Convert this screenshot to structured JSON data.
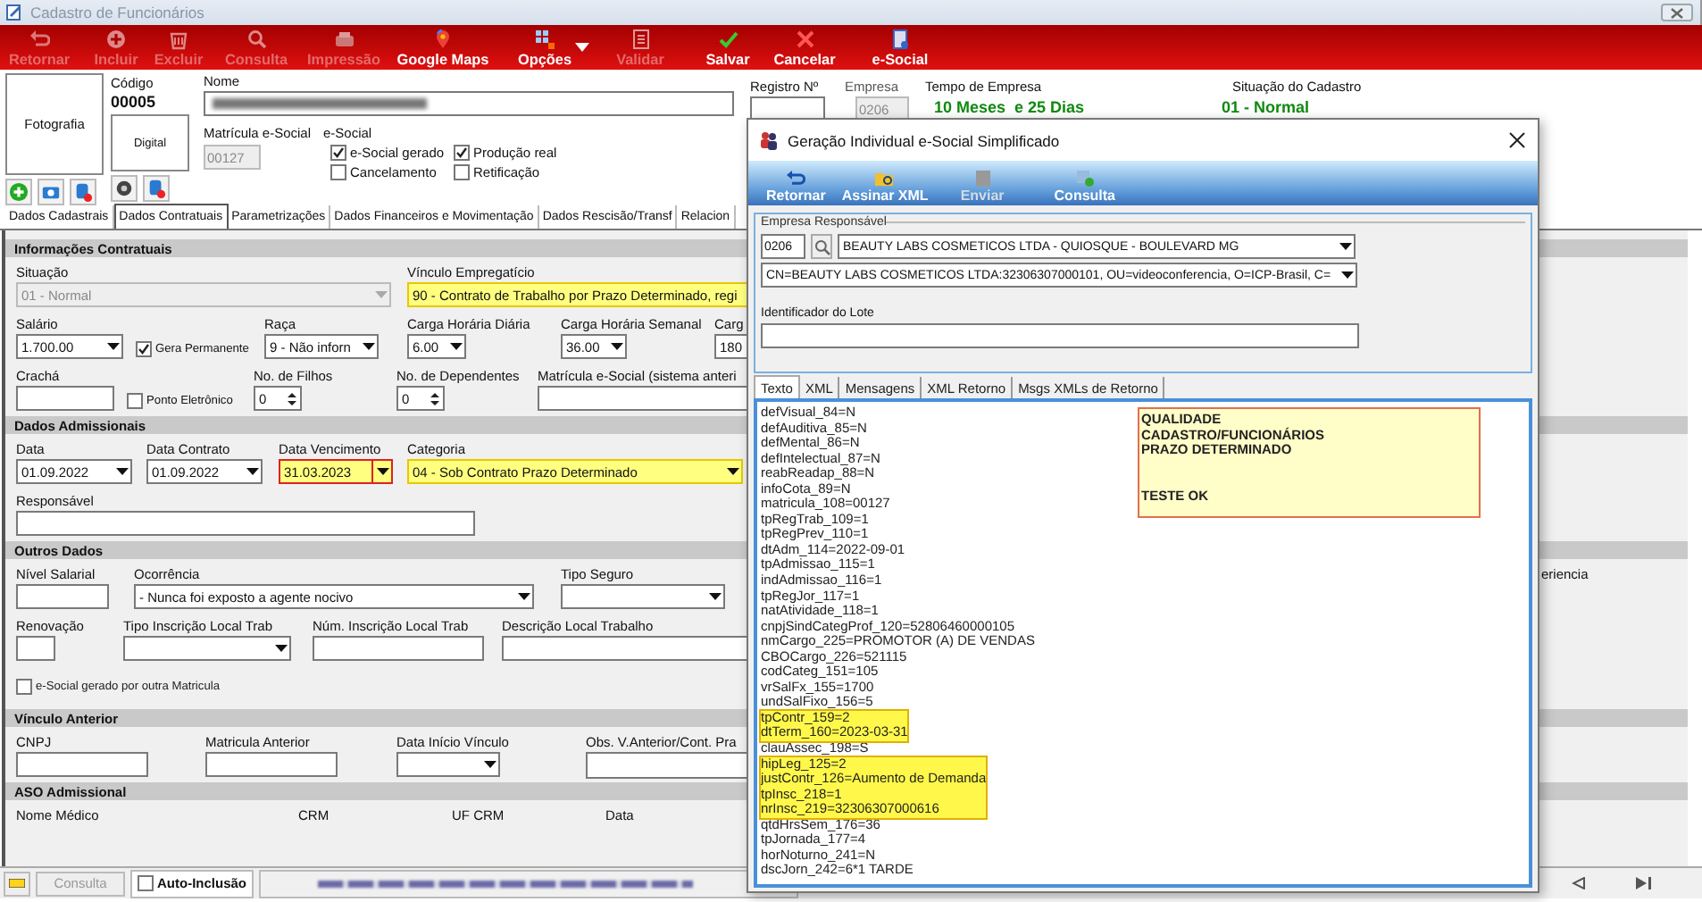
{
  "window": {
    "title": "Cadastro de Funcionários"
  },
  "toolbar": [
    {
      "label": "Retornar",
      "disabled": true
    },
    {
      "label": "Incluir",
      "disabled": true
    },
    {
      "label": "Excluir",
      "disabled": true
    },
    {
      "label": "Consulta",
      "disabled": true
    },
    {
      "label": "Impressão",
      "disabled": true
    },
    {
      "label": "Google Maps",
      "disabled": false
    },
    {
      "label": "Opções",
      "disabled": false,
      "dropdown": true
    },
    {
      "label": "Validar",
      "disabled": true
    },
    {
      "label": "Salvar",
      "disabled": false
    },
    {
      "label": "Cancelar",
      "disabled": false
    },
    {
      "label": "e-Social",
      "disabled": false
    }
  ],
  "header": {
    "photo": "Fotografia",
    "codigo_label": "Código",
    "codigo": "00005",
    "digital": "Digital",
    "nome_label": "Nome",
    "matricula_label": "Matrícula e-Social",
    "matricula": "00127",
    "esocial_label": "e-Social",
    "esocial_checks": [
      {
        "label": "e-Social gerado",
        "checked": true
      },
      {
        "label": "Produção real",
        "checked": true
      },
      {
        "label": "Cancelamento",
        "checked": false
      },
      {
        "label": "Retificação",
        "checked": false
      }
    ],
    "registro_label": "Registro Nº",
    "empresa_label": "Empresa",
    "empresa": "0206",
    "tempo_label": "Tempo de Empresa",
    "tempo": "10 Meses  e 25 Dias",
    "situacao_label": "Situação do Cadastro",
    "situacao": "01 - Normal"
  },
  "tabs": [
    {
      "label": "Dados Cadastrais",
      "selected": false
    },
    {
      "label": "Dados Contratuais",
      "selected": true
    },
    {
      "label": "Parametrizações",
      "selected": false
    },
    {
      "label": "Dados Financeiros e Movimentação",
      "selected": false
    },
    {
      "label": "Dados Rescisão/Transf",
      "selected": false
    },
    {
      "label": "Relacion",
      "selected": false
    }
  ],
  "sections": [
    {
      "title": "Informações Contratuais",
      "lines": [
        {
          "fields": [
            {
              "kind": "select",
              "label": "Situação",
              "value": "01 - Normal",
              "disabled": true
            },
            {
              "kind": "select",
              "label": "Vínculo Empregatício",
              "value": "90 - Contrato de Trabalho por Prazo Determinado, regi",
              "highlighted": true
            }
          ]
        },
        {
          "fields": [
            {
              "kind": "select",
              "label": "Salário",
              "value": "1.700.00"
            },
            {
              "kind": "checkbox",
              "label": "Gera Permanente",
              "checked": true
            },
            {
              "kind": "select",
              "label": "Raça",
              "value": "9 - Não inforn"
            },
            {
              "kind": "select",
              "label": "Carga Horária Diária",
              "value": "6.00"
            },
            {
              "kind": "select",
              "label": "Carga Horária Semanal",
              "value": "36.00"
            },
            {
              "kind": "text",
              "label": "Carg",
              "value": "180"
            }
          ]
        },
        {
          "fields": [
            {
              "kind": "text",
              "label": "Crachá"
            },
            {
              "kind": "checkbox",
              "label": "Ponto Eletrônico",
              "checked": false
            },
            {
              "kind": "spin",
              "label": "No. de Filhos",
              "value": "0"
            },
            {
              "kind": "spin",
              "label": "No. de Dependentes",
              "value": "0"
            },
            {
              "kind": "text",
              "label": "Matrícula e-Social (sistema anteri"
            }
          ]
        }
      ]
    },
    {
      "title": "Dados Admissionais",
      "lines": [
        {
          "fields": [
            {
              "kind": "select",
              "label": "Data",
              "value": "01.09.2022"
            },
            {
              "kind": "select",
              "label": "Data Contrato",
              "value": "01.09.2022"
            },
            {
              "kind": "select",
              "label": "Data Vencimento",
              "value": "31.03.2023",
              "highlighted": true,
              "flagged": true
            },
            {
              "kind": "select",
              "label": "Categoria",
              "value": "04 - Sob Contrato Prazo Determinado",
              "highlighted": true
            }
          ]
        },
        {
          "fields": [
            {
              "kind": "text",
              "label": "Responsável"
            }
          ]
        }
      ]
    },
    {
      "title": "Outros Dados",
      "lines": [
        {
          "fields": [
            {
              "kind": "text",
              "label": "Nível Salarial"
            },
            {
              "kind": "select",
              "label": "Ocorrência",
              "value": "- Nunca foi exposto a agente nocivo"
            },
            {
              "kind": "select",
              "label": "Tipo Seguro"
            },
            {
              "kind": "label",
              "label": "eriencia"
            }
          ]
        },
        {
          "fields": [
            {
              "kind": "text",
              "label": "Renovação"
            },
            {
              "kind": "select",
              "label": "Tipo Inscrição Local Trab"
            },
            {
              "kind": "text",
              "label": "Núm. Inscrição Local Trab"
            },
            {
              "kind": "text",
              "label": "Descrição Local Trabalho"
            }
          ]
        },
        {
          "fields": [
            {
              "kind": "checkbox",
              "label": "e-Social gerado por outra Matricula",
              "checked": false
            }
          ]
        }
      ]
    },
    {
      "title": "Vínculo Anterior",
      "lines": [
        {
          "fields": [
            {
              "kind": "text",
              "label": "CNPJ"
            },
            {
              "kind": "text",
              "label": "Matricula Anterior"
            },
            {
              "kind": "select",
              "label": "Data Início Vínculo"
            },
            {
              "kind": "memo",
              "label": "Obs.  V.Anterior/Cont. Pra"
            }
          ]
        }
      ]
    },
    {
      "title": "ASO Admissional",
      "lines": [
        {
          "fields": [
            {
              "kind": "label",
              "label": "Nome Médico"
            },
            {
              "kind": "label",
              "label": "CRM"
            },
            {
              "kind": "label",
              "label": "UF CRM"
            },
            {
              "kind": "label",
              "label": "Data"
            }
          ]
        }
      ]
    }
  ],
  "status_bar": {
    "consulta": {
      "label": "Consulta",
      "disabled": true
    },
    "auto_inclusao": {
      "label": "Auto-Inclusão",
      "checked": false
    }
  },
  "dialog": {
    "title": "Geração Individual e-Social Simplificado",
    "toolbar": [
      {
        "label": "Retornar",
        "disabled": false
      },
      {
        "label": "Assinar XML",
        "disabled": false
      },
      {
        "label": "Enviar",
        "disabled": true
      },
      {
        "label": "Consulta",
        "disabled": false
      }
    ],
    "group_label": "Empresa Responsável",
    "empresa_code": "0206",
    "empresa_name": "BEAUTY LABS COSMETICOS LTDA - QUIOSQUE - BOULEVARD MG",
    "certificate": "CN=BEAUTY LABS COSMETICOS LTDA:32306307000101, OU=videoconferencia, O=ICP-Brasil, C=",
    "lote_label": "Identificador do Lote",
    "tabs": [
      {
        "label": "Texto",
        "selected": true
      },
      {
        "label": "XML",
        "selected": false
      },
      {
        "label": "Mensagens",
        "selected": false
      },
      {
        "label": "XML Retorno",
        "selected": false
      },
      {
        "label": "Msgs XMLs de Retorno",
        "selected": false
      }
    ],
    "lines": [
      {
        "text": "defVisual_84=N",
        "highlighted": false
      },
      {
        "text": "defAuditiva_85=N",
        "highlighted": false
      },
      {
        "text": "defMental_86=N",
        "highlighted": false
      },
      {
        "text": "defIntelectual_87=N",
        "highlighted": false
      },
      {
        "text": "reabReadap_88=N",
        "highlighted": false
      },
      {
        "text": "infoCota_89=N",
        "highlighted": false
      },
      {
        "text": "matricula_108=00127",
        "highlighted": false
      },
      {
        "text": "tpRegTrab_109=1",
        "highlighted": false
      },
      {
        "text": "tpRegPrev_110=1",
        "highlighted": false
      },
      {
        "text": "dtAdm_114=2022-09-01",
        "highlighted": false
      },
      {
        "text": "tpAdmissao_115=1",
        "highlighted": false
      },
      {
        "text": "indAdmissao_116=1",
        "highlighted": false
      },
      {
        "text": "tpRegJor_117=1",
        "highlighted": false
      },
      {
        "text": "natAtividade_118=1",
        "highlighted": false
      },
      {
        "text": "cnpjSindCategProf_120=52806460000105",
        "highlighted": false
      },
      {
        "text": "nmCargo_225=PROMOTOR (A) DE VENDAS",
        "highlighted": false
      },
      {
        "text": "CBOCargo_226=521115",
        "highlighted": false
      },
      {
        "text": "codCateg_151=105",
        "highlighted": false
      },
      {
        "text": "vrSalFx_155=1700",
        "highlighted": false
      },
      {
        "text": "undSalFixo_156=5",
        "highlighted": false
      },
      {
        "text": "tpContr_159=2",
        "highlighted": true
      },
      {
        "text": "dtTerm_160=2023-03-31",
        "highlighted": true
      },
      {
        "text": "clauAssec_198=S",
        "highlighted": false
      },
      {
        "text": "hipLeg_125=2",
        "highlighted": true
      },
      {
        "text": "justContr_126=Aumento de Demanda",
        "highlighted": true
      },
      {
        "text": "tpInsc_218=1",
        "highlighted": true
      },
      {
        "text": "nrInsc_219=32306307000616",
        "highlighted": true
      },
      {
        "text": "qtdHrsSem_176=36",
        "highlighted": false
      },
      {
        "text": "tpJornada_177=4",
        "highlighted": false
      },
      {
        "text": "horNoturno_241=N",
        "highlighted": false
      },
      {
        "text": "dscJorn_242=6*1 TARDE",
        "highlighted": false
      }
    ],
    "note": {
      "lines": [
        "QUALIDADE",
        "CADASTRO/FUNCIONÁRIOS",
        "PRAZO DETERMINADO"
      ],
      "footer": "TESTE OK"
    }
  }
}
